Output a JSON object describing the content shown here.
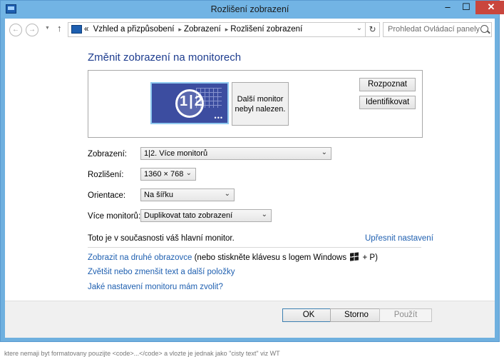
{
  "window": {
    "title": "Rozlišení zobrazení",
    "minimize": "–",
    "maximize": "☐",
    "close": "✕",
    "accent": "#72b4e4"
  },
  "address_bar": {
    "back_icon": "←",
    "forward_icon": "→",
    "up_icon": "↑",
    "overflow": "«",
    "crumbs": [
      "Vzhled a přizpůsobení",
      "Zobrazení",
      "Rozlišení zobrazení"
    ],
    "crumb_separator": "▸",
    "dropdown_icon": "⌄",
    "refresh_icon": "↻",
    "search_placeholder": "Prohledat Ovládací panely"
  },
  "main": {
    "heading": "Změnit zobrazení na monitorech",
    "monitor_main_label": "1|2",
    "monitor_main_dots": "•••",
    "monitor_other_label": "Další monitor nebyl nalezen.",
    "detect_button": "Rozpoznat",
    "identify_button": "Identifikovat",
    "form": {
      "display_label": "Zobrazení:",
      "display_value": "1|2. Více monitorů",
      "resolution_label": "Rozlišení:",
      "resolution_value": "1360 × 768",
      "orientation_label": "Orientace:",
      "orientation_value": "Na šířku",
      "multi_label": "Více monitorů:",
      "multi_value": "Duplikovat tato zobrazení"
    },
    "info_text": "Toto je v současnosti váš hlavní monitor.",
    "advanced_link": "Upřesnit nastavení",
    "project_link": "Zobrazit na druhé obrazovce",
    "project_hint_before": "(nebo stiskněte klávesu s logem Windows",
    "project_hint_after": "+ P)",
    "text_size_link": "Zvětšit nebo zmenšit text a další položky",
    "help_link": "Jaké nastavení monitoru mám zvolit?"
  },
  "footer": {
    "ok": "OK",
    "cancel": "Storno",
    "apply": "Použít"
  },
  "below_text": "ktere nemaji byt formatovany pouzijte <code>...</code> a vlozte je jednak jako \"cisty text\" viz WT"
}
